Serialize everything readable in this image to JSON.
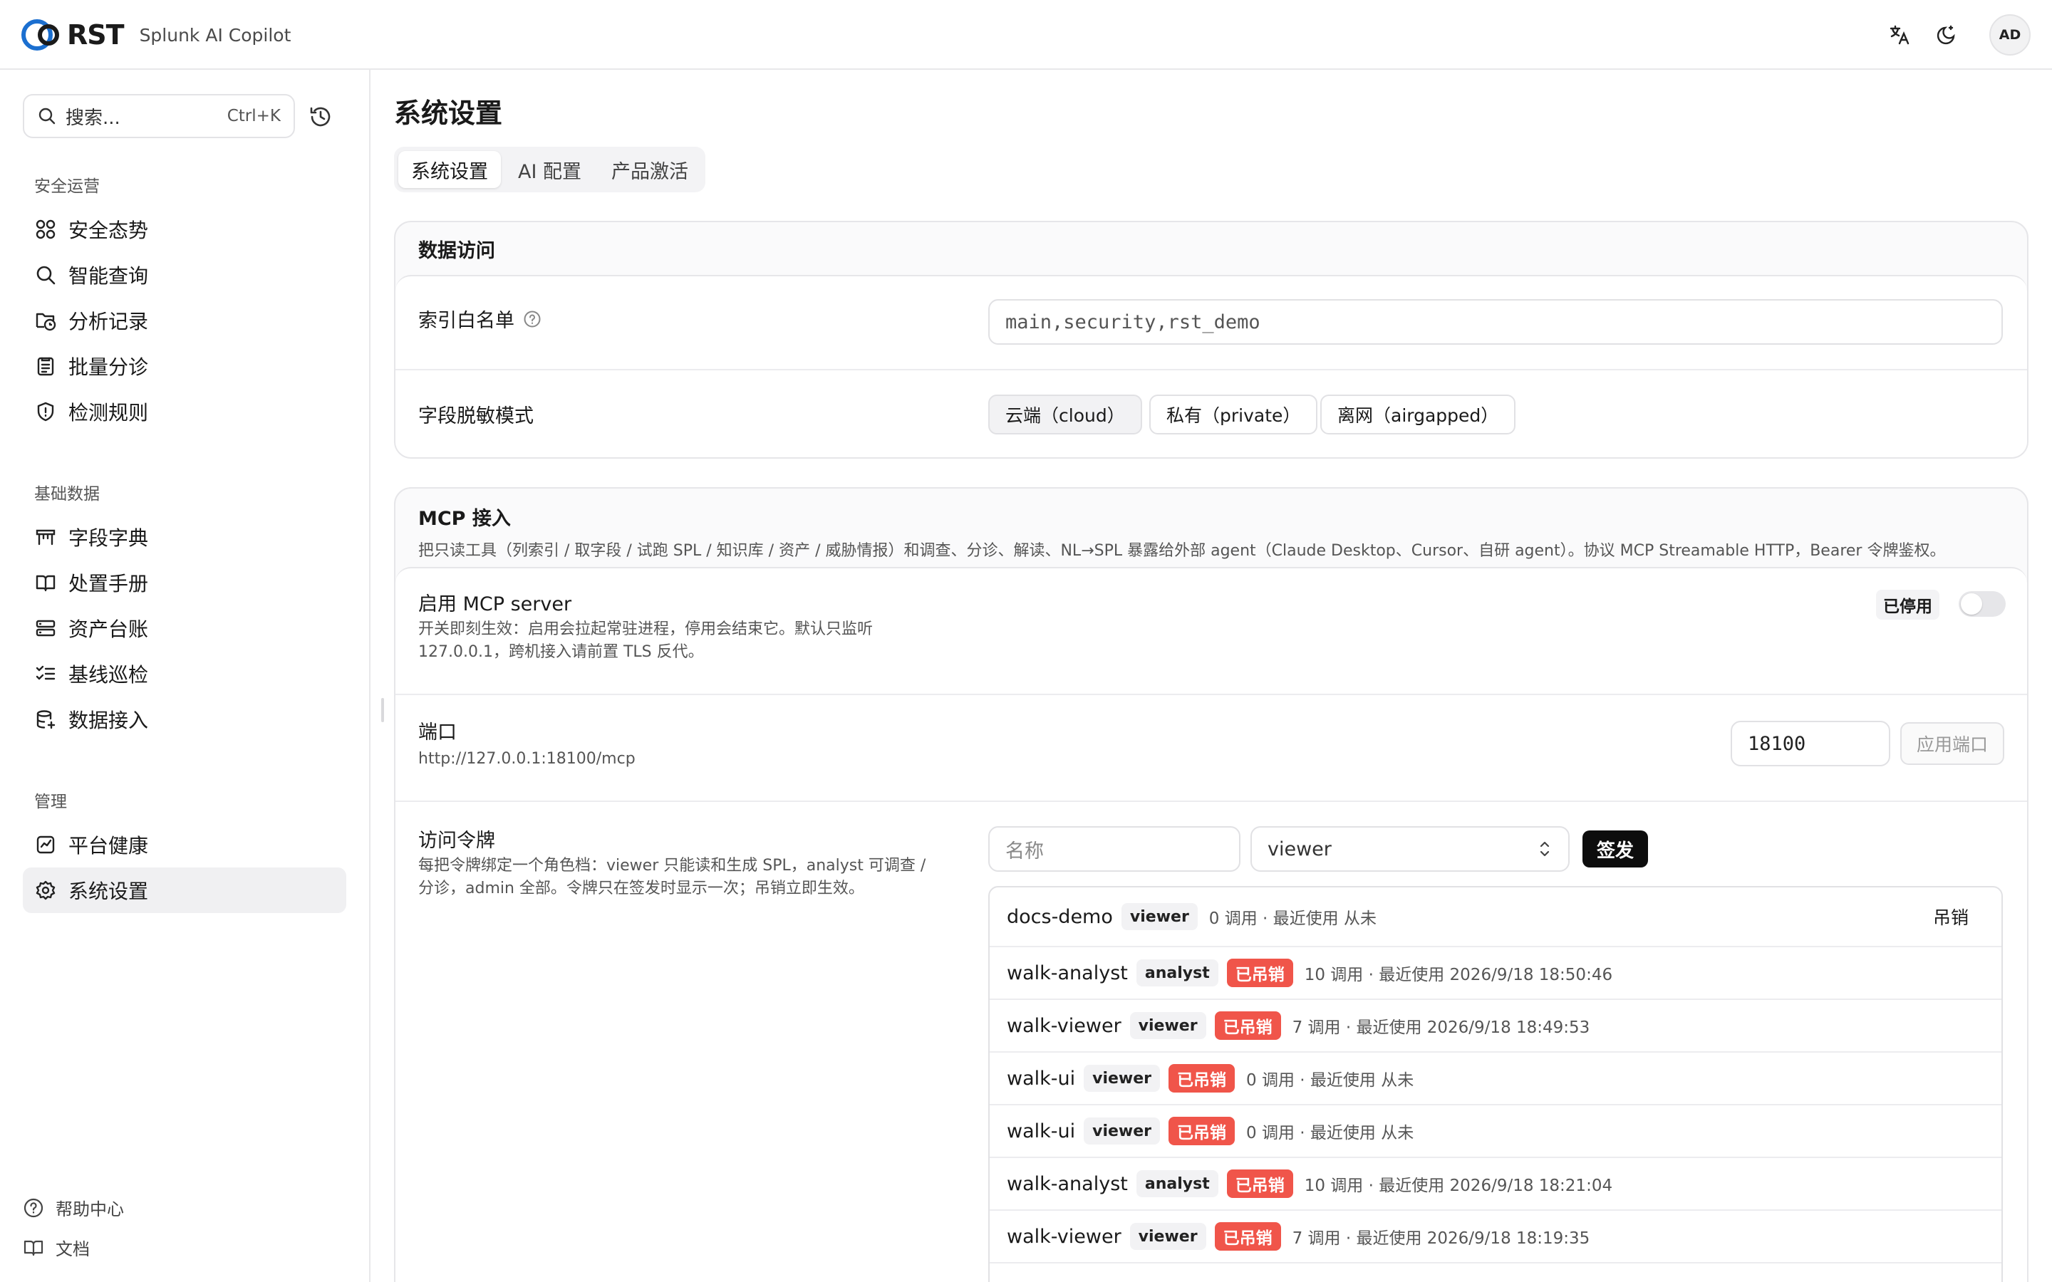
{
  "app": {
    "logo_text": "RST",
    "product_name": "Splunk AI Copilot",
    "avatar_initials": "AD"
  },
  "sidebar": {
    "search_placeholder": "搜索...",
    "search_shortcut": "Ctrl+K",
    "groups": [
      {
        "title": "安全运营",
        "items": [
          {
            "label": "安全态势",
            "icon": "dashboard-grid-icon"
          },
          {
            "label": "智能查询",
            "icon": "search-icon"
          },
          {
            "label": "分析记录",
            "icon": "folder-clock-icon"
          },
          {
            "label": "批量分诊",
            "icon": "clipboard-list-icon"
          },
          {
            "label": "检测规则",
            "icon": "shield-alert-icon"
          }
        ]
      },
      {
        "title": "基础数据",
        "items": [
          {
            "label": "字段字典",
            "icon": "table-icon"
          },
          {
            "label": "处置手册",
            "icon": "book-open-icon"
          },
          {
            "label": "资产台账",
            "icon": "server-icon"
          },
          {
            "label": "基线巡检",
            "icon": "checklist-icon"
          },
          {
            "label": "数据接入",
            "icon": "database-plus-icon"
          }
        ]
      },
      {
        "title": "管理",
        "items": [
          {
            "label": "平台健康",
            "icon": "activity-chart-icon"
          },
          {
            "label": "系统设置",
            "icon": "gear-icon",
            "active": true
          }
        ]
      }
    ],
    "footer": [
      {
        "label": "帮助中心",
        "icon": "help-circle-icon"
      },
      {
        "label": "文档",
        "icon": "book-icon"
      }
    ]
  },
  "main": {
    "title": "系统设置",
    "tabs": [
      {
        "label": "系统设置",
        "active": true
      },
      {
        "label": "AI 配置"
      },
      {
        "label": "产品激活"
      }
    ],
    "data_access": {
      "title": "数据访问",
      "index_whitelist_label": "索引白名单",
      "index_whitelist_value": "main,security,rst_demo",
      "masking_label": "字段脱敏模式",
      "masking_options": [
        "云端（cloud）",
        "私有（private）",
        "离网（airgapped）"
      ],
      "masking_selected": "云端（cloud）"
    },
    "mcp": {
      "title": "MCP 接入",
      "desc": "把只读工具（列索引 / 取字段 / 试跑 SPL / 知识库 / 资产 / 威胁情报）和调查、分诊、解读、NL→SPL 暴露给外部 agent（Claude Desktop、Cursor、自研 agent）。协议 MCP Streamable HTTP，Bearer 令牌鉴权。",
      "enable_label": "启用 MCP server",
      "enable_desc_1": "开关即刻生效：启用会拉起常驻进程，停用会结束它。默认只监听",
      "enable_desc_2": "127.0.0.1，跨机接入请前置 TLS 反代。",
      "status_label": "已停用",
      "enabled": false,
      "port_label": "端口",
      "port_url": "http://127.0.0.1:18100/mcp",
      "port_value": "18100",
      "apply_port_label": "应用端口",
      "token_label": "访问令牌",
      "token_desc_1": "每把令牌绑定一个角色档：viewer 只能读和生成 SPL，analyst 可调查 /",
      "token_desc_2": "分诊，admin 全部。令牌只在签发时显示一次；吊销立即生效。",
      "name_placeholder": "名称",
      "role_selected": "viewer",
      "issue_label": "签发",
      "revoke_label": "吊销",
      "revoked_label": "已吊销",
      "tokens": [
        {
          "name": "docs-demo",
          "role": "viewer",
          "revoked": false,
          "meta": "0 调用 · 最近使用 从未"
        },
        {
          "name": "walk-analyst",
          "role": "analyst",
          "revoked": true,
          "meta": "10 调用 · 最近使用 2026/9/18 18:50:46"
        },
        {
          "name": "walk-viewer",
          "role": "viewer",
          "revoked": true,
          "meta": "7 调用 · 最近使用 2026/9/18 18:49:53"
        },
        {
          "name": "walk-ui",
          "role": "viewer",
          "revoked": true,
          "meta": "0 调用 · 最近使用 从未"
        },
        {
          "name": "walk-ui",
          "role": "viewer",
          "revoked": true,
          "meta": "0 调用 · 最近使用 从未"
        },
        {
          "name": "walk-analyst",
          "role": "analyst",
          "revoked": true,
          "meta": "10 调用 · 最近使用 2026/9/18 18:21:04"
        },
        {
          "name": "walk-viewer",
          "role": "viewer",
          "revoked": true,
          "meta": "7 调用 · 最近使用 2026/9/18 18:19:35"
        }
      ]
    }
  },
  "colors": {
    "brand_blue": "#1b6fd0",
    "revoked_red": "#f0554a",
    "issue_button": "#0d0d0d"
  }
}
